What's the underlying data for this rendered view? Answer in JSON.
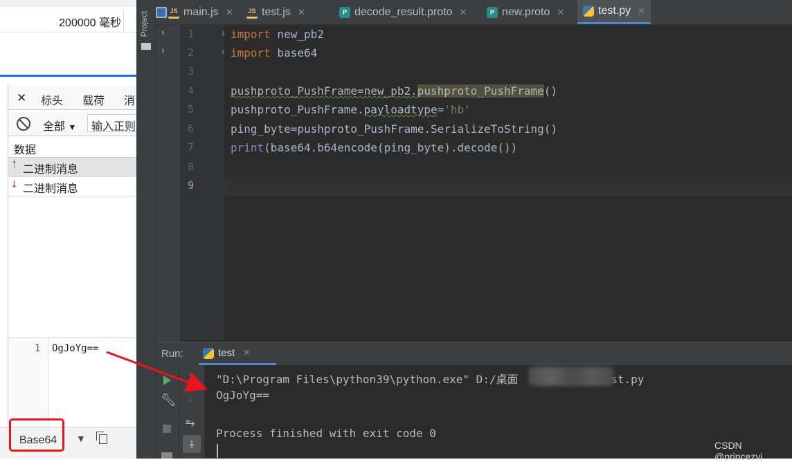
{
  "devtools": {
    "timing_value": "200000 毫秒",
    "tabs": {
      "headers": "标头",
      "payload": "载荷",
      "messages_partial": "消"
    },
    "filter": {
      "type_selected": "全部",
      "regex_placeholder": "输入正则"
    },
    "messages_header": "数据",
    "messages": [
      {
        "direction_icon": "up-arrow",
        "label": "二进制消息"
      },
      {
        "direction_icon": "down-arrow",
        "label": "二进制消息"
      }
    ],
    "content": {
      "line_number": "1",
      "text": "OgJoYg=="
    },
    "format_select": "Base64",
    "colors": {
      "highlight_box": "#e8151b",
      "annotation_arrow": "#e8151b"
    }
  },
  "ide": {
    "project_tool": "Project",
    "tabs": [
      {
        "label": "main.js",
        "icon": "js-icon"
      },
      {
        "label": "test.js",
        "icon": "js-icon"
      },
      {
        "label": "decode_result.proto",
        "icon": "proto-icon"
      },
      {
        "label": "new.proto",
        "icon": "proto-icon"
      },
      {
        "label": "test.py",
        "icon": "python-icon",
        "active": true
      }
    ],
    "line_numbers": [
      "1",
      "2",
      "3",
      "4",
      "5",
      "6",
      "7",
      "8",
      "9"
    ],
    "code": {
      "l1_kw": "import",
      "l1_mod": " new_pb2",
      "l2_kw": "import",
      "l2_mod": " base64",
      "l4_a": "pushproto_PushFrame=new_pb2.",
      "l4_b": "pushproto_PushFrame",
      "l4_c": "()",
      "l5_a": "pushproto_PushFrame.",
      "l5_b": "payloadtype",
      "l5_c": "=",
      "l5_str": "'hb'",
      "l6": "ping_byte=pushproto_PushFrame.SerializeToString()",
      "l7_fn": "print",
      "l7_rest": "(base64.b64encode(ping_byte).decode())"
    },
    "run": {
      "label": "Run:",
      "tab": "test",
      "console": [
        "\"D:\\Program Files\\python39\\python.exe\" D:/桌面",
        "est.py",
        "OgJoYg==",
        "Process finished with exit code 0"
      ]
    }
  },
  "watermark": "CSDN @princezyj"
}
